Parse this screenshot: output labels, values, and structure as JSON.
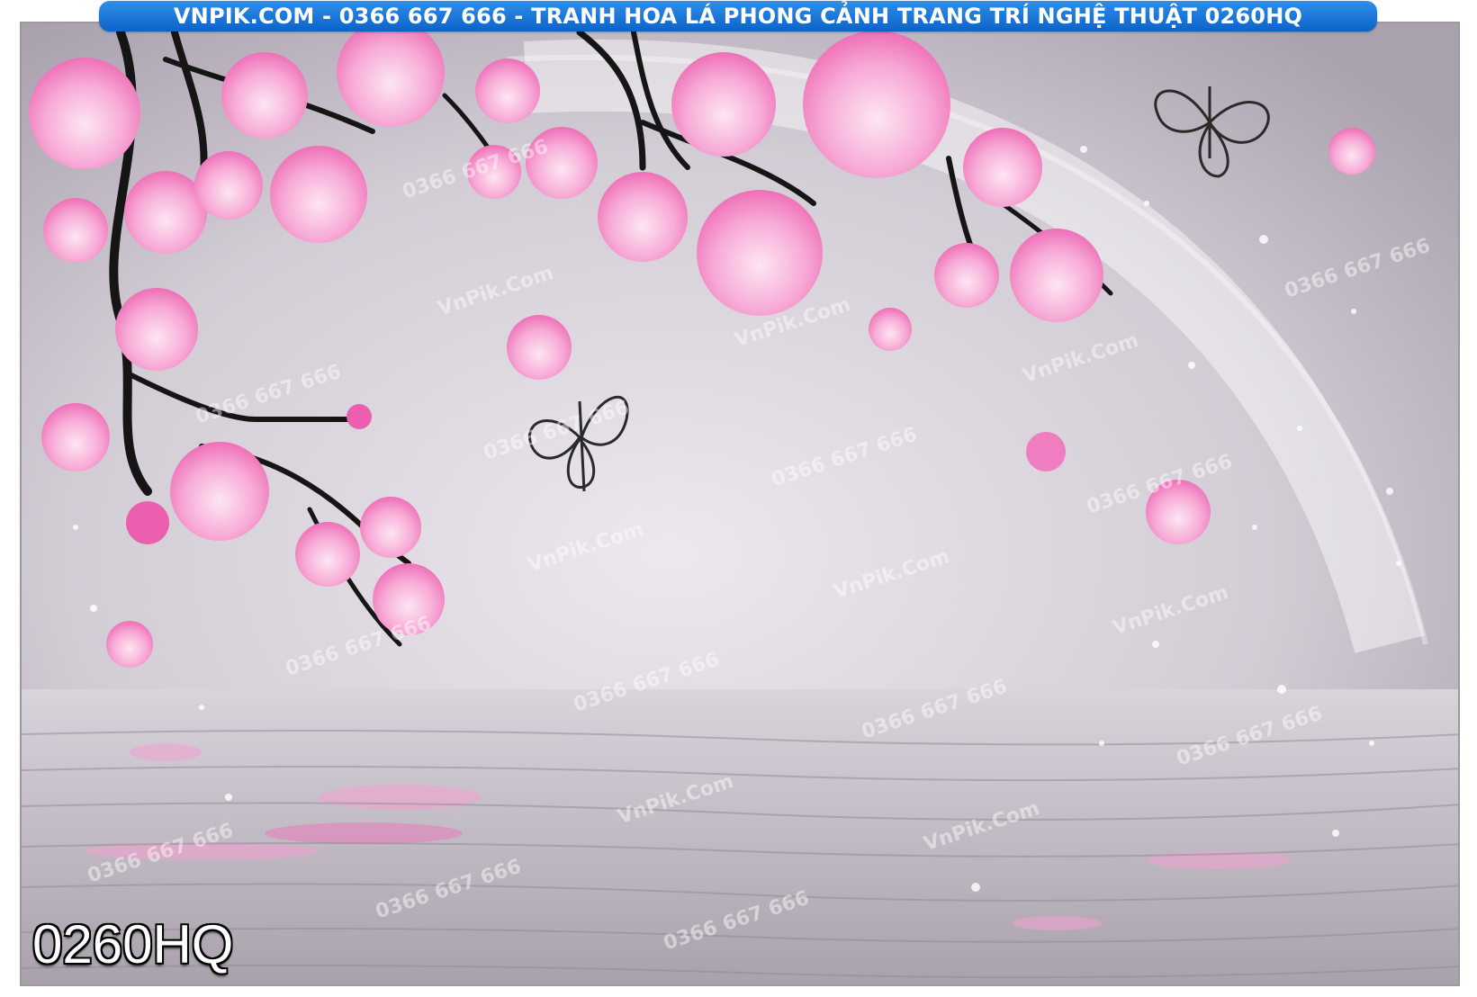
{
  "banner": {
    "text": "VNPIK.COM - 0366 667 666 - TRANH HOA LÁ PHONG CẢNH TRANG TRÍ NGHỆ THUẬT 0260HQ",
    "background": "#1a74d8"
  },
  "product_code": "0260HQ",
  "watermarks": [
    "VnPik.Com",
    "0366 667 666"
  ],
  "palette": {
    "background": "#cbc4cd",
    "blossom": "#f7a9d6",
    "blossom_deep": "#ec5fae",
    "branch": "#1a1a1a",
    "butterfly": "#2a2a2a",
    "water": "#bdb6c0"
  }
}
